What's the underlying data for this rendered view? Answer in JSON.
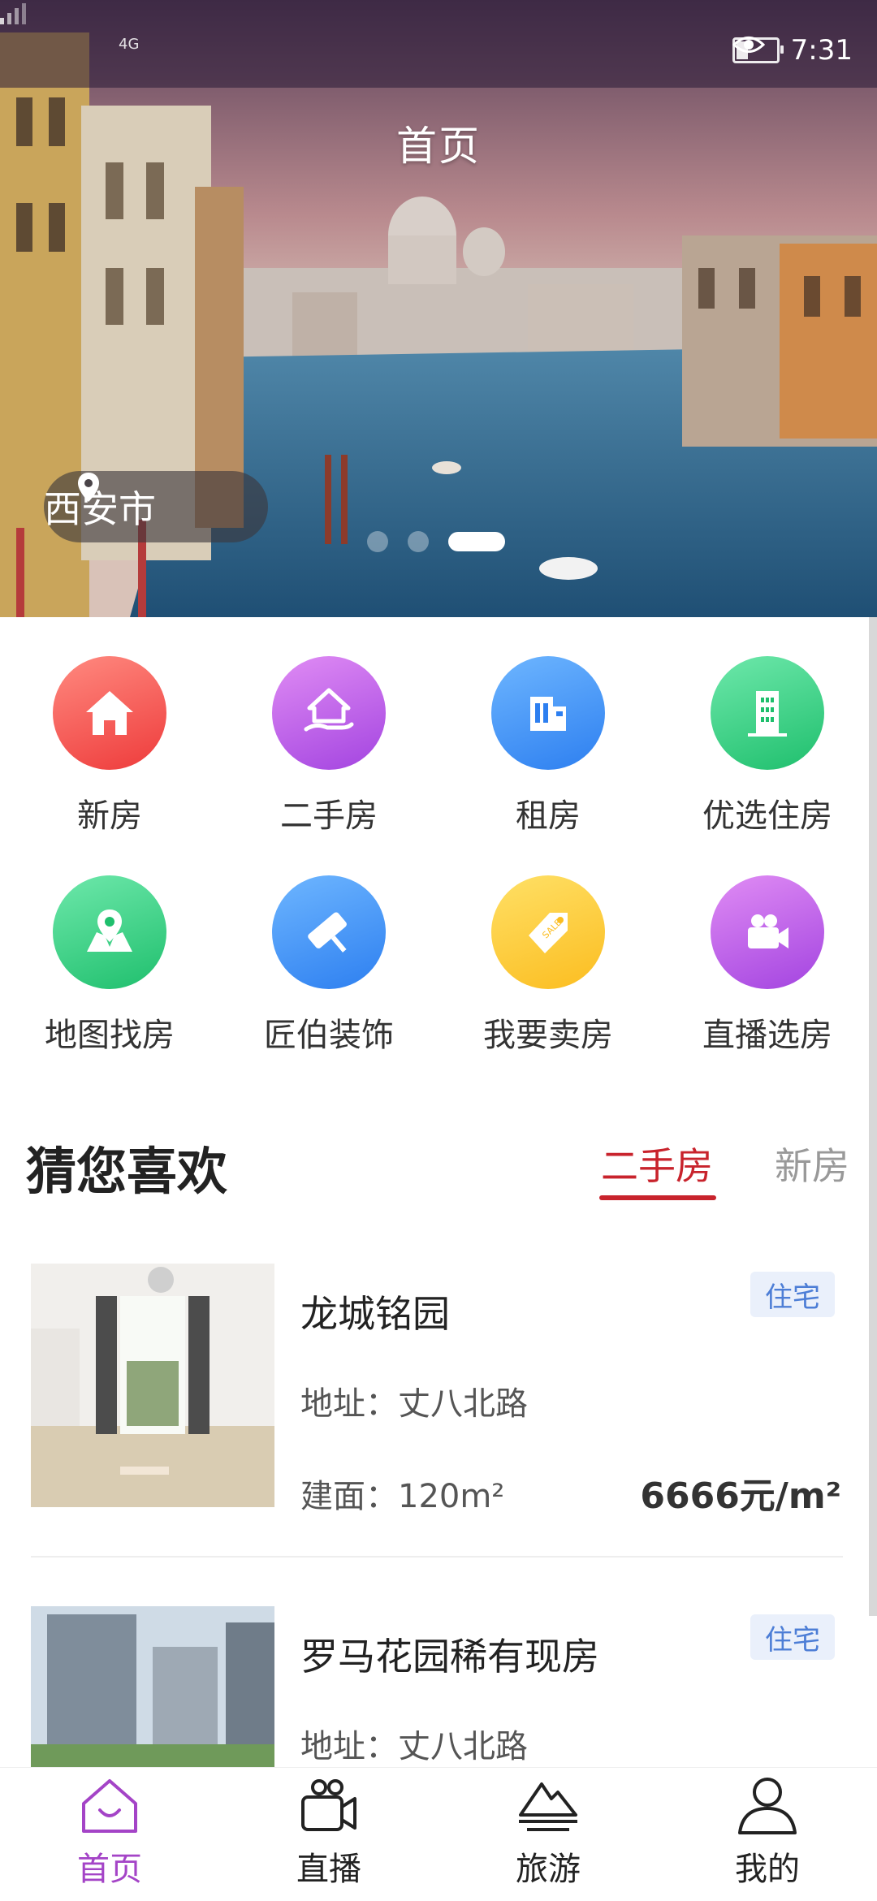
{
  "status_bar": {
    "network": "4G",
    "time": "7:31"
  },
  "header": {
    "title": "首页",
    "city": "西安市"
  },
  "carousel": {
    "slide_count": 3,
    "active_index": 2
  },
  "menu": [
    {
      "label": "新房",
      "icon": "house-icon",
      "color": "#ee3b3b"
    },
    {
      "label": "二手房",
      "icon": "house-hand-icon",
      "color": "#a344e0"
    },
    {
      "label": "租房",
      "icon": "building-icon",
      "color": "#2d7ff0"
    },
    {
      "label": "优选住房",
      "icon": "tower-icon",
      "color": "#1fbf6d"
    },
    {
      "label": "地图找房",
      "icon": "map-pin-icon",
      "color": "#1fbf6d"
    },
    {
      "label": "匠伯装饰",
      "icon": "paint-roller-icon",
      "color": "#2d7ff0"
    },
    {
      "label": "我要卖房",
      "icon": "sale-tag-icon",
      "color": "#fbbd20"
    },
    {
      "label": "直播选房",
      "icon": "video-camera-icon",
      "color": "#a344e0"
    }
  ],
  "recommend": {
    "title": "猜您喜欢",
    "tabs": [
      {
        "label": "二手房",
        "active": true
      },
      {
        "label": "新房",
        "active": false
      }
    ],
    "items": [
      {
        "title": "龙城铭园",
        "badge": "住宅",
        "address": "地址：丈八北路",
        "area": "建面：120m²",
        "price": "6666元/m²"
      },
      {
        "title": "罗马花园稀有现房",
        "badge": "住宅",
        "address": "地址：丈八北路"
      }
    ]
  },
  "bottom_nav": [
    {
      "label": "首页",
      "icon": "home-icon",
      "active": true
    },
    {
      "label": "直播",
      "icon": "camera-icon",
      "active": false
    },
    {
      "label": "旅游",
      "icon": "mountain-icon",
      "active": false
    },
    {
      "label": "我的",
      "icon": "user-icon",
      "active": false
    }
  ],
  "colors": {
    "accent": "#c8232c",
    "nav_active": "#a444c7",
    "badge_text": "#4d7ed6"
  }
}
